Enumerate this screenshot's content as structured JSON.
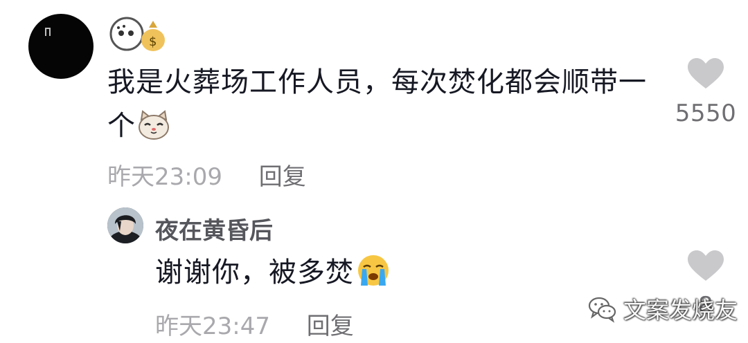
{
  "comment": {
    "username_icon": "money-bag-face-emoji",
    "text": "我是火葬场工作人员，每次焚化都会顺带一个",
    "text_emoji": "cat-face-emoji",
    "time": "昨天23:09",
    "reply_label": "回复",
    "like_icon": "heart-icon",
    "like_count": "5550"
  },
  "reply": {
    "username": "夜在黄昏后",
    "text": "谢谢你，被多焚",
    "text_emoji": "crying-face-emoji",
    "time": "昨天23:47",
    "reply_label": "回复",
    "like_icon": "heart-icon",
    "like_count": "8"
  },
  "watermark": {
    "icon": "wechat-icon",
    "text": "文案发烧友"
  }
}
